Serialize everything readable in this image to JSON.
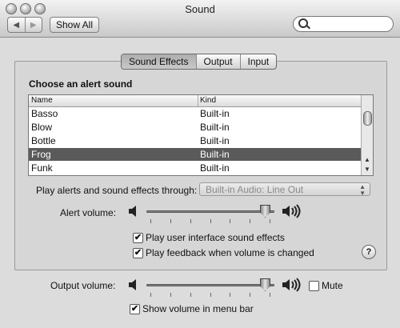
{
  "window": {
    "title": "Sound"
  },
  "toolbar": {
    "back_icon": "back-arrow-icon",
    "forward_icon": "forward-arrow-icon",
    "show_all_label": "Show All",
    "search_placeholder": ""
  },
  "tabs": [
    {
      "label": "Sound Effects",
      "active": true
    },
    {
      "label": "Output",
      "active": false
    },
    {
      "label": "Input",
      "active": false
    }
  ],
  "alert": {
    "heading": "Choose an alert sound",
    "columns": [
      "Name",
      "Kind"
    ],
    "rows": [
      {
        "name": "Basso",
        "kind": "Built-in",
        "selected": false
      },
      {
        "name": "Blow",
        "kind": "Built-in",
        "selected": false
      },
      {
        "name": "Bottle",
        "kind": "Built-in",
        "selected": false
      },
      {
        "name": "Frog",
        "kind": "Built-in",
        "selected": true
      },
      {
        "name": "Funk",
        "kind": "Built-in",
        "selected": false
      }
    ]
  },
  "through": {
    "label": "Play alerts and sound effects through:",
    "value": "Built-in Audio: Line Out"
  },
  "alert_volume": {
    "label": "Alert volume:",
    "value": 0.95
  },
  "options": {
    "ui_sounds": {
      "label": "Play user interface sound effects",
      "checked": true
    },
    "feedback": {
      "label": "Play feedback when volume is changed",
      "checked": true
    }
  },
  "help_label": "?",
  "output_volume": {
    "label": "Output volume:",
    "value": 0.95,
    "mute_label": "Mute",
    "muted": false
  },
  "menu_bar": {
    "label": "Show volume in menu bar",
    "checked": true
  },
  "check_mark": "✔"
}
